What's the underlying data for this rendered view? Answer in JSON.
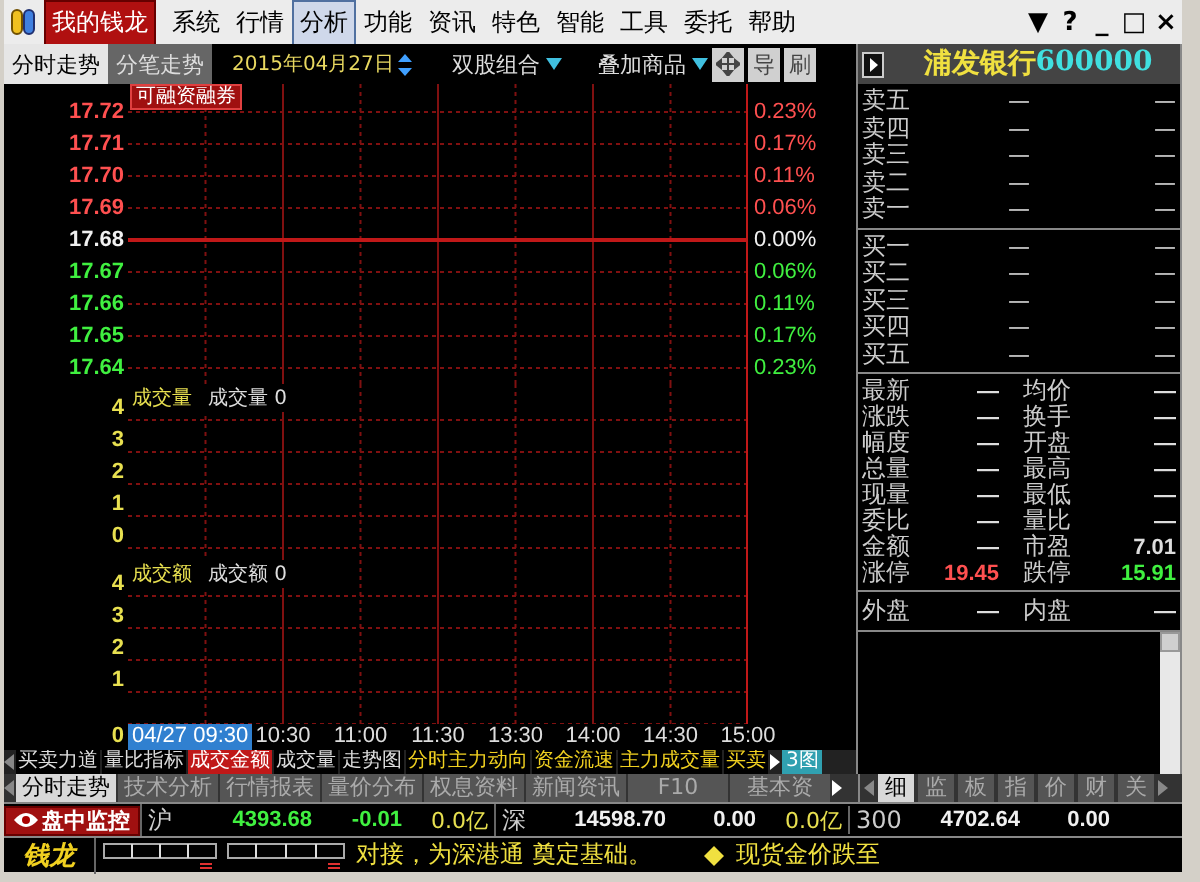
{
  "menu_bar": {
    "brand": "我的钱龙",
    "items": [
      {
        "label": "系统",
        "selected": false
      },
      {
        "label": "行情",
        "selected": false
      },
      {
        "label": "分析",
        "selected": true
      },
      {
        "label": "功能",
        "selected": false
      },
      {
        "label": "资讯",
        "selected": false
      },
      {
        "label": "特色",
        "selected": false
      },
      {
        "label": "智能",
        "selected": false
      },
      {
        "label": "工具",
        "selected": false
      },
      {
        "label": "委托",
        "selected": false
      },
      {
        "label": "帮助",
        "selected": false
      }
    ],
    "window_controls": [
      "▼",
      "?",
      "_",
      "□",
      "×"
    ]
  },
  "toolbar": {
    "tabs": [
      {
        "label": "分时走势",
        "selected": true
      },
      {
        "label": "分笔走势",
        "selected": false
      }
    ],
    "date": "2015年04月27日",
    "dual_stock": "双股组合",
    "overlay": "叠加商品",
    "buttons": [
      "导",
      "刷"
    ]
  },
  "quote_header": {
    "name": "浦发银行",
    "code": "600000"
  },
  "price_chart": {
    "tag": "可融资融券",
    "rows": [
      {
        "price": "17.72",
        "change": "0.23%",
        "kind": "up"
      },
      {
        "price": "17.71",
        "change": "0.17%",
        "kind": "up"
      },
      {
        "price": "17.70",
        "change": "0.11%",
        "kind": "up"
      },
      {
        "price": "17.69",
        "change": "0.06%",
        "kind": "up"
      },
      {
        "price": "17.68",
        "change": "0.00%",
        "kind": "flat"
      },
      {
        "price": "17.67",
        "change": "0.06%",
        "kind": "down"
      },
      {
        "price": "17.66",
        "change": "0.11%",
        "kind": "down"
      },
      {
        "price": "17.65",
        "change": "0.17%",
        "kind": "down"
      },
      {
        "price": "17.64",
        "change": "0.23%",
        "kind": "down"
      }
    ]
  },
  "volume_panel": {
    "title": "成交量",
    "reading": "成交量 0",
    "ticks": [
      "4",
      "3",
      "2",
      "1",
      "0"
    ]
  },
  "amount_panel": {
    "title": "成交额",
    "reading": "成交额 0",
    "ticks": [
      "4",
      "3",
      "2",
      "1"
    ]
  },
  "time_axis": {
    "origin": "0",
    "labels": [
      {
        "text": "04/27 09:30",
        "selected": true
      },
      {
        "text": "10:30",
        "selected": false
      },
      {
        "text": "11:00",
        "selected": false
      },
      {
        "text": "11:30",
        "selected": false
      },
      {
        "text": "13:30",
        "selected": false
      },
      {
        "text": "14:00",
        "selected": false
      },
      {
        "text": "14:30",
        "selected": false
      },
      {
        "text": "15:00",
        "selected": false
      }
    ]
  },
  "indicator_tabs": {
    "items": [
      {
        "label": "买卖力道",
        "selected": false,
        "kind": "plain"
      },
      {
        "label": "量比指标",
        "selected": false,
        "kind": "plain"
      },
      {
        "label": "成交金额",
        "selected": true,
        "kind": "plain"
      },
      {
        "label": "成交量",
        "selected": false,
        "kind": "plain"
      },
      {
        "label": "走势图",
        "selected": false,
        "kind": "plain"
      },
      {
        "label": "分时主力动向",
        "selected": false,
        "kind": "premium"
      },
      {
        "label": "资金流速",
        "selected": false,
        "kind": "premium"
      },
      {
        "label": "主力成交量",
        "selected": false,
        "kind": "premium"
      },
      {
        "label": "买卖",
        "selected": false,
        "kind": "premium"
      }
    ],
    "layout_button": "3图"
  },
  "order_book": {
    "asks": [
      {
        "label": "卖五",
        "price": "—",
        "volume": "—"
      },
      {
        "label": "卖四",
        "price": "—",
        "volume": "—"
      },
      {
        "label": "卖三",
        "price": "—",
        "volume": "—"
      },
      {
        "label": "卖二",
        "price": "—",
        "volume": "—"
      },
      {
        "label": "卖一",
        "price": "—",
        "volume": "—"
      }
    ],
    "bids": [
      {
        "label": "买一",
        "price": "—",
        "volume": "—"
      },
      {
        "label": "买二",
        "price": "—",
        "volume": "—"
      },
      {
        "label": "买三",
        "price": "—",
        "volume": "—"
      },
      {
        "label": "买四",
        "price": "—",
        "volume": "—"
      },
      {
        "label": "买五",
        "price": "—",
        "volume": "—"
      }
    ]
  },
  "stats": [
    {
      "label": "最新",
      "value": "—"
    },
    {
      "label": "均价",
      "value": "—"
    },
    {
      "label": "涨跌",
      "value": "—"
    },
    {
      "label": "换手",
      "value": "—"
    },
    {
      "label": "幅度",
      "value": "—"
    },
    {
      "label": "开盘",
      "value": "—"
    },
    {
      "label": "总量",
      "value": "—"
    },
    {
      "label": "最高",
      "value": "—"
    },
    {
      "label": "现量",
      "value": "—"
    },
    {
      "label": "最低",
      "value": "—"
    },
    {
      "label": "委比",
      "value": "—"
    },
    {
      "label": "量比",
      "value": "—"
    },
    {
      "label": "金额",
      "value": "—"
    },
    {
      "label": "市盈",
      "value": "7.01"
    },
    {
      "label": "涨停",
      "value": "19.45",
      "color": "#ff5050"
    },
    {
      "label": "跌停",
      "value": "15.91",
      "color": "#40f040"
    }
  ],
  "trade_side": [
    {
      "label": "外盘",
      "value": "—"
    },
    {
      "label": "内盘",
      "value": "—"
    }
  ],
  "bottom_tabs": {
    "left": [
      {
        "label": "分时走势",
        "selected": true
      },
      {
        "label": "技术分析",
        "selected": false
      },
      {
        "label": "行情报表",
        "selected": false
      },
      {
        "label": "量价分布",
        "selected": false
      },
      {
        "label": "权息资料",
        "selected": false
      },
      {
        "label": "新闻资讯",
        "selected": false
      },
      {
        "label": "F10",
        "selected": false
      },
      {
        "label": "基本资",
        "selected": false
      }
    ],
    "right": [
      {
        "label": "细",
        "selected": true
      },
      {
        "label": "监",
        "selected": false
      },
      {
        "label": "板",
        "selected": false
      },
      {
        "label": "指",
        "selected": false
      },
      {
        "label": "价",
        "selected": false
      },
      {
        "label": "财",
        "selected": false
      },
      {
        "label": "关",
        "selected": false
      }
    ]
  },
  "index_bar": {
    "monitor": "盘中监控",
    "markets": [
      {
        "name": "沪",
        "price": "4393.68",
        "change": "-0.01",
        "amount": "0.0亿",
        "color": "#40f040"
      },
      {
        "name": "深",
        "price": "14598.70",
        "change": "0.00",
        "amount": "0.0亿",
        "color": "#f0f0f0"
      },
      {
        "name": "300",
        "price": "4702.64",
        "change": "0.00",
        "color": "#f0f0f0"
      }
    ]
  },
  "ticker": {
    "logo": "钱龙",
    "headlines": [
      "对接，为深港通 奠定基础。",
      "现货金价跌至"
    ]
  }
}
